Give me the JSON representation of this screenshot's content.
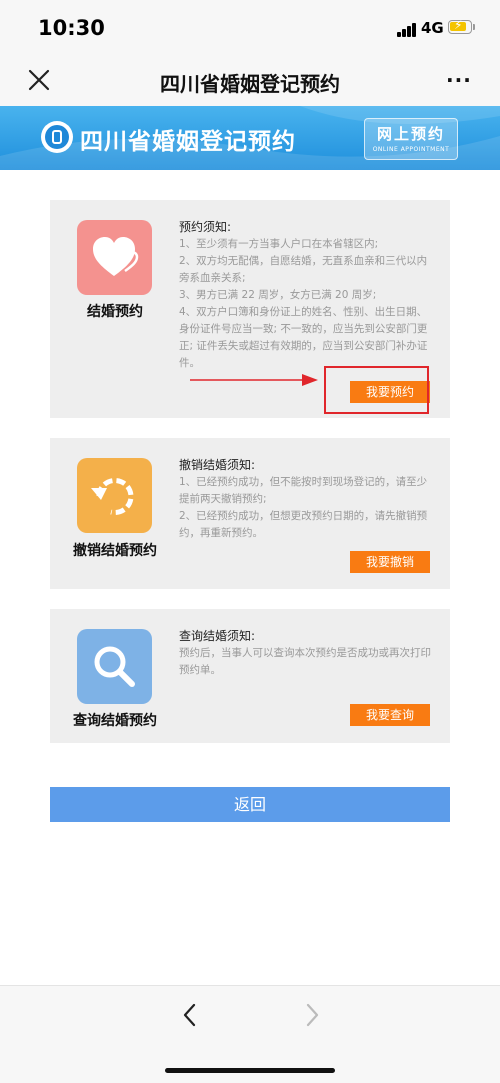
{
  "status_bar": {
    "time": "10:30",
    "network": "4G"
  },
  "nav": {
    "title": "四川省婚姻登记预约",
    "more": "···"
  },
  "banner": {
    "title": "四川省婚姻登记预约",
    "button_main": "网上预约",
    "button_sub": "ONLINE APPOINTMENT"
  },
  "cards": [
    {
      "name": "结婚预约",
      "icon": "heart-icon",
      "color": "#f4928f",
      "heading": "预约须知:",
      "items": [
        "1、至少须有一方当事人户口在本省辖区内;",
        "2、双方均无配偶，自愿结婚，无直系血亲和三代以内旁系血亲关系;",
        "3、男方已满 22 周岁，女方已满 20 周岁;",
        "4、双方户口簿和身份证上的姓名、性别、出生日期、身份证件号应当一致; 不一致的，应当先到公安部门更正; 证件丢失或超过有效期的，应当到公安部门补办证件。"
      ],
      "button": "我要预约"
    },
    {
      "name": "撤销结婚预约",
      "icon": "undo-icon",
      "color": "#f4b04a",
      "heading": "撤销结婚须知:",
      "items": [
        "1、已经预约成功，但不能按时到现场登记的，请至少提前两天撤销预约;",
        "2、已经预约成功，但想更改预约日期的，请先撤销预约，再重新预约。"
      ],
      "button": "我要撤销"
    },
    {
      "name": "查询结婚预约",
      "icon": "search-icon",
      "color": "#7eb2e6",
      "heading": "查询结婚须知:",
      "items": [
        "预约后，当事人可以查询本次预约是否成功或再次打印预约单。"
      ],
      "button": "我要查询"
    }
  ],
  "back_button": "返回",
  "colors": {
    "accent": "#f97b12",
    "banner": "#2a97e0",
    "back": "#5c9cea",
    "highlight": "#e0262b"
  }
}
